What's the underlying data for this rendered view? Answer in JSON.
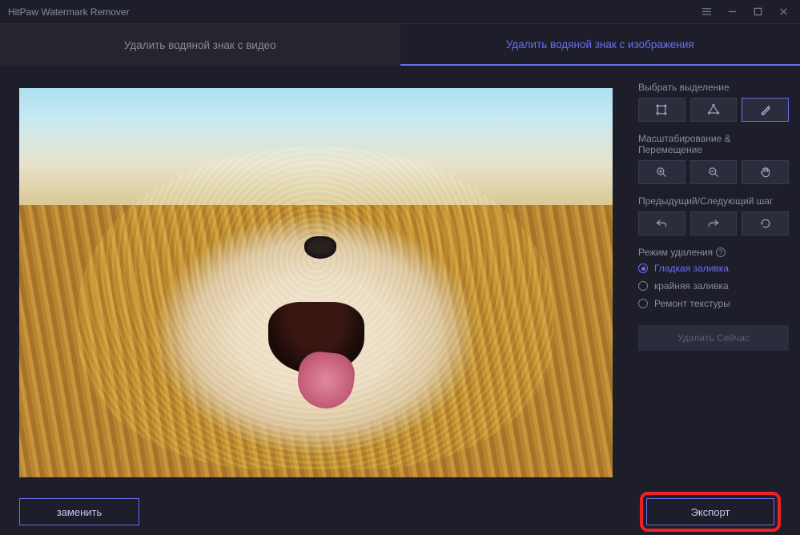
{
  "app": {
    "title": "HitPaw Watermark Remover"
  },
  "tabs": {
    "video": "Удалить водяной знак с видео",
    "image": "Удалить водяной знак с изображения"
  },
  "sidebar": {
    "selection_label": "Выбрать выделение",
    "zoom_label": "Масштабирование & Перемещение",
    "history_label": "Предыдущий/Следующий шаг",
    "mode_label": "Режим удаления",
    "modes": {
      "smooth": "Гладкая заливка",
      "edge": "крайняя заливка",
      "texture": "Ремонт текстуры"
    },
    "remove_now": "Удалить Сейчас"
  },
  "footer": {
    "replace": "заменить",
    "export": "Экспорт"
  },
  "icons": {
    "help": "?"
  }
}
